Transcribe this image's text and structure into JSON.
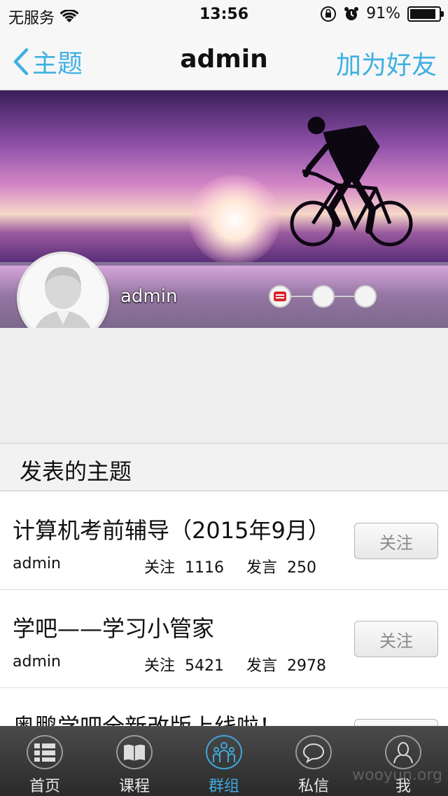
{
  "status_bar": {
    "carrier": "无服务",
    "time": "13:56",
    "battery": "91%",
    "battery_level": 0.91
  },
  "nav": {
    "back_label": "主题",
    "title": "admin",
    "action_label": "加为好友"
  },
  "profile": {
    "username": "admin",
    "level_steps": 3,
    "level_current": 1
  },
  "section": {
    "title": "发表的主题"
  },
  "topics": [
    {
      "title": "计算机考前辅导（2015年9月）",
      "author": "admin",
      "follow_label": "关注",
      "follow_count": "1116",
      "post_label": "发言",
      "post_count": "250",
      "button": "关注"
    },
    {
      "title": "学吧——学习小管家",
      "author": "admin",
      "follow_label": "关注",
      "follow_count": "5421",
      "post_label": "发言",
      "post_count": "2978",
      "button": "关注"
    },
    {
      "title": "奥鹏学吧全新改版上线啦！",
      "author": "",
      "follow_label": "",
      "follow_count": "",
      "post_label": "",
      "post_count": "",
      "button": ""
    }
  ],
  "tabs": [
    {
      "label": "首页",
      "icon": "grid-list-icon"
    },
    {
      "label": "课程",
      "icon": "book-icon"
    },
    {
      "label": "群组",
      "icon": "group-icon",
      "active": true
    },
    {
      "label": "私信",
      "icon": "chat-bubble-icon"
    },
    {
      "label": "我",
      "icon": "user-icon"
    }
  ],
  "watermark": "wooyun.org",
  "colors": {
    "accent": "#3fb0e2",
    "tab_active": "#3fa8dc",
    "level_mark": "#d9262b"
  }
}
